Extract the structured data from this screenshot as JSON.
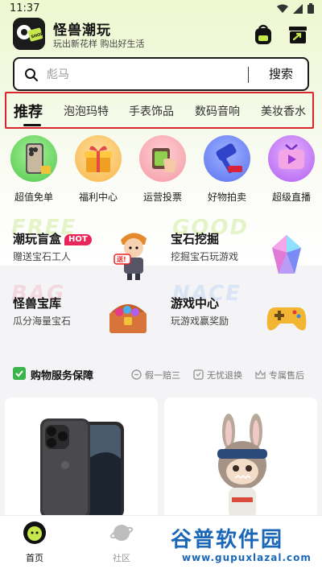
{
  "status_bar": {
    "time": "11:37"
  },
  "header": {
    "title": "怪兽潮玩",
    "slogan": "玩出新花样 购出好生活",
    "logo_text": "SHOP"
  },
  "search": {
    "placeholder": "彪马",
    "button_label": "搜索"
  },
  "tabs": [
    "推荐",
    "泡泡玛特",
    "手表饰品",
    "数码音响",
    "美妆香水"
  ],
  "quick_icons": [
    {
      "label": "超值免单",
      "icon": "phone-gift-icon"
    },
    {
      "label": "福利中心",
      "icon": "gift-box-icon"
    },
    {
      "label": "运营投票",
      "icon": "vote-hand-icon"
    },
    {
      "label": "好物拍卖",
      "icon": "auction-gavel-icon"
    },
    {
      "label": "超级直播",
      "icon": "live-tv-icon"
    }
  ],
  "features": [
    {
      "title": "潮玩盲盒",
      "badge": "HOT",
      "subtitle": "赠送宝石工人",
      "ghost": "FREE"
    },
    {
      "title": "宝石挖掘",
      "subtitle": "挖掘宝石玩游戏",
      "ghost": "GOOD"
    },
    {
      "title": "怪兽宝库",
      "subtitle": "瓜分海量宝石",
      "ghost": "BAG"
    },
    {
      "title": "游戏中心",
      "subtitle": "玩游戏赢奖励",
      "ghost": "NACE"
    }
  ],
  "guarantee": {
    "title": "购物服务保障",
    "items": [
      "假一赔三",
      "无忧退换",
      "专属售后"
    ]
  },
  "bottom_nav": [
    {
      "label": "首页",
      "active": true
    },
    {
      "label": "社区",
      "active": false
    }
  ],
  "watermark": {
    "big": "谷普软件园",
    "small": "www.gupuxlazal.com"
  },
  "colors": {
    "accent_red": "#d9252b",
    "hot_badge": "#e8265a",
    "active_nav": "#111111",
    "watermark_blue": "#1a67b8"
  }
}
